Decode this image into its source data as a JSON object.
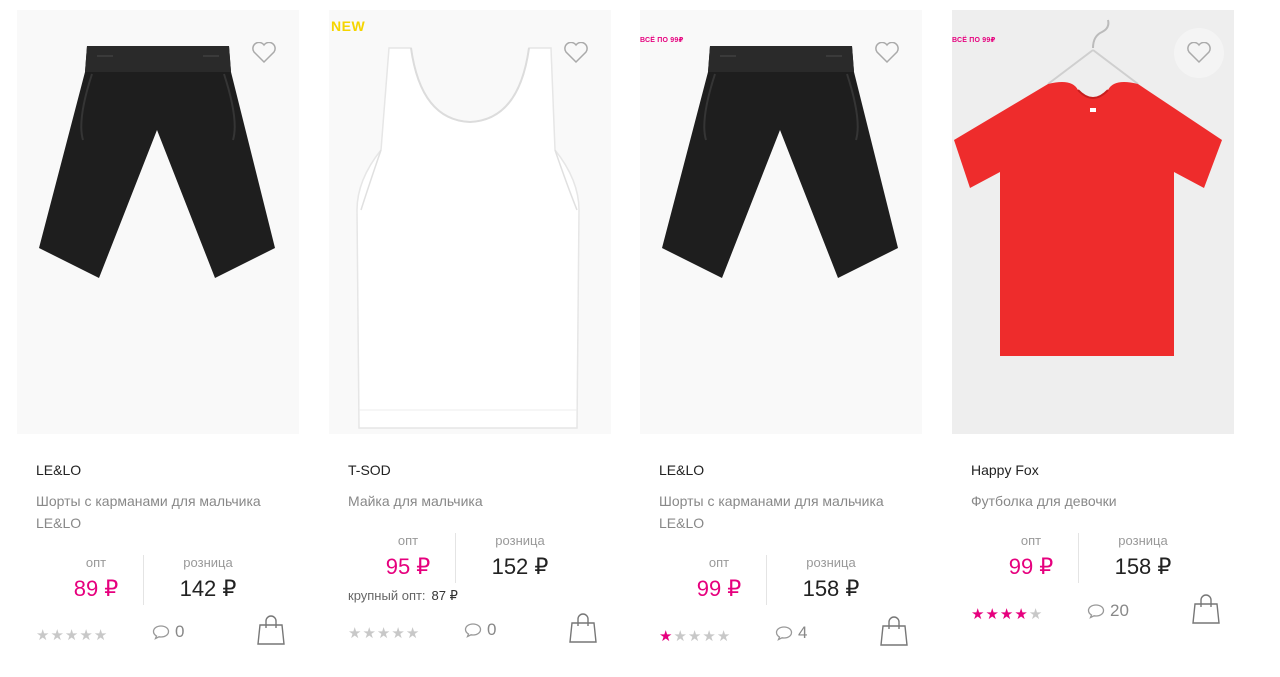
{
  "currency": "₽",
  "colors": {
    "accent": "#e6007e",
    "new_badge": "#f5d500",
    "muted": "#999999"
  },
  "products": [
    {
      "brand": "LE&LO",
      "title": "Шорты с карманами для мальчика LE&LO",
      "badge": "",
      "opt_label": "опт",
      "retail_label": "розница",
      "opt_price": "89 ₽",
      "retail_price": "142 ₽",
      "bulk_label": "",
      "bulk_price": "",
      "rating": 0,
      "reviews": "0",
      "image": "black-shorts"
    },
    {
      "brand": "T-SOD",
      "title": "Майка для мальчика",
      "badge": "NEW",
      "opt_label": "опт",
      "retail_label": "розница",
      "opt_price": "95 ₽",
      "retail_price": "152 ₽",
      "bulk_label": "крупный опт:",
      "bulk_price": "87 ₽",
      "rating": 0,
      "reviews": "0",
      "image": "white-tank-top"
    },
    {
      "brand": "LE&LO",
      "title": "Шорты с карманами для мальчика LE&LO",
      "badge": "ВСЁ ПО 99₽",
      "opt_label": "опт",
      "retail_label": "розница",
      "opt_price": "99 ₽",
      "retail_price": "158 ₽",
      "bulk_label": "",
      "bulk_price": "",
      "rating": 1,
      "reviews": "4",
      "image": "black-shorts"
    },
    {
      "brand": "Happy Fox",
      "title": "Футболка для девочки",
      "badge": "ВСЁ ПО 99₽",
      "opt_label": "опт",
      "retail_label": "розница",
      "opt_price": "99 ₽",
      "retail_price": "158 ₽",
      "bulk_label": "",
      "bulk_price": "",
      "rating": 4,
      "reviews": "20",
      "image": "red-tshirt-on-hanger"
    }
  ]
}
